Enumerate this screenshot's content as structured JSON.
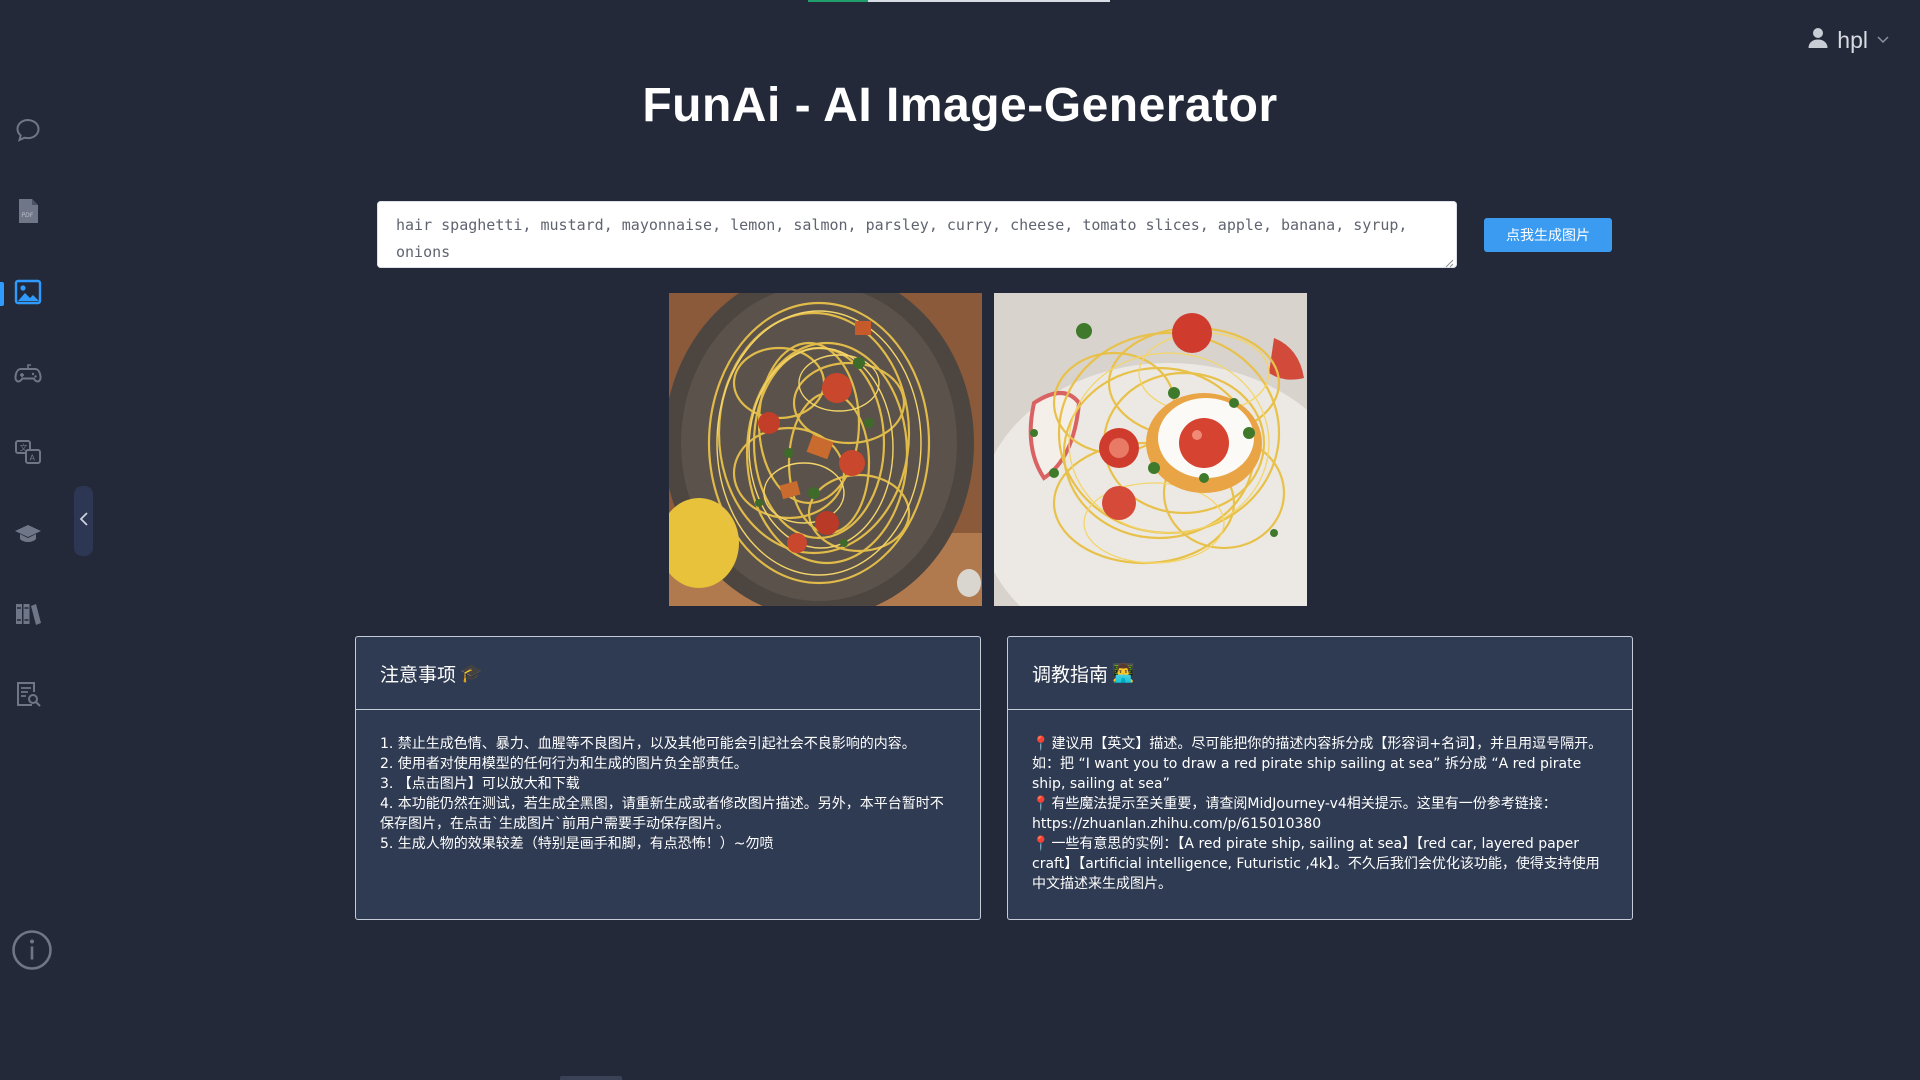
{
  "app": {
    "title": "FunAi - AI Image-Generator",
    "username": "hpl",
    "load_progress": 0.2
  },
  "sidebar": {
    "items": [
      {
        "icon": "chat-bubble-icon",
        "label": "chat"
      },
      {
        "icon": "pdf-icon",
        "label": "pdf"
      },
      {
        "icon": "image-icon",
        "label": "image",
        "active": true
      },
      {
        "icon": "gamepad-icon",
        "label": "game"
      },
      {
        "icon": "translate-icon",
        "label": "translate"
      },
      {
        "icon": "graduation-cap-icon",
        "label": "study"
      },
      {
        "icon": "books-icon",
        "label": "library"
      },
      {
        "icon": "document-search-icon",
        "label": "search"
      }
    ],
    "collapse_icon": "chevron-left-icon",
    "info_icon": "info-icon",
    "accent": "#2f9bff"
  },
  "prompt": {
    "value": "hair spaghetti, mustard, mayonnaise, lemon, salmon, parsley, curry, cheese, tomato slices, apple, banana, syrup, onions"
  },
  "generate_button": {
    "label": "点我生成图片",
    "color": "#3a9bf1"
  },
  "results": [
    {
      "icon": "spaghetti-plate-image"
    },
    {
      "icon": "spaghetti-egg-image"
    }
  ],
  "notice": {
    "title": "注意事项",
    "emoji": "🎓",
    "lines": [
      "1. 禁止生成色情、暴力、血腥等不良图片，以及其他可能会引起社会不良影响的内容。",
      "2. 使用者对使用模型的任何行为和生成的图片负全部责任。",
      "3. 【点击图片】可以放大和下载",
      "4. 本功能仍然在测试，若生成全黑图，请重新生成或者修改图片描述。另外，本平台暂时不保存图片，在点击`生成图片`前用户需要手动保存图片。",
      "5. 生成人物的效果较差（特别是画手和脚，有点恐怖！）~勿喷"
    ]
  },
  "guide": {
    "title": "调教指南",
    "emoji": "👨‍💻",
    "pin_icon": "📍",
    "lines": [
      "建议用【英文】描述。尽可能把你的描述内容拆分成【形容词+名词】，并且用逗号隔开。如：把 “I want you to draw a red pirate ship sailing at sea” 拆分成 “A red pirate ship, sailing at sea”",
      "有些魔法提示至关重要，请查阅MidJourney-v4相关提示。这里有一份参考链接：https://zhuanlan.zhihu.com/p/615010380",
      "一些有意思的实例：【A red pirate ship, sailing at sea】【red car, layered paper craft】【artificial intelligence, Futuristic ,4k】。不久后我们会优化该功能，使得支持使用中文描述来生成图片。"
    ]
  }
}
